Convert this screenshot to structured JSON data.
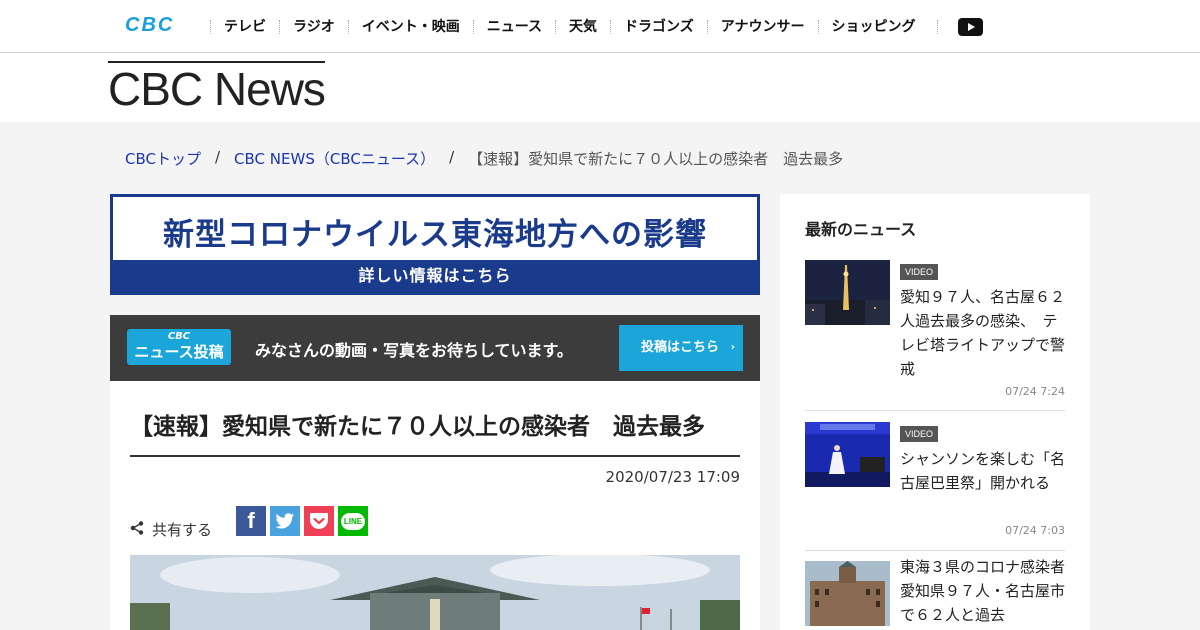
{
  "header": {
    "logo": "CBC",
    "nav": [
      "テレビ",
      "ラジオ",
      "イベント・映画",
      "ニュース",
      "天気",
      "ドラゴンズ",
      "アナウンサー",
      "ショッピング"
    ]
  },
  "masthead": {
    "brand": "CBC News"
  },
  "breadcrumb": {
    "home": "CBCトップ",
    "section": "CBC NEWS（CBCニュース）",
    "current": "【速報】愛知県で新たに７０人以上の感染者　過去最多",
    "separator": "/"
  },
  "banner_covid": {
    "main": "新型コロナウイルス東海地方への影響",
    "sub": "詳しい情報はこちら"
  },
  "banner_submit": {
    "badge_small": "CBC",
    "badge_big": "ニュース投稿",
    "text": "みなさんの動画・写真をお待ちしています。",
    "button": "投稿はこちら",
    "arrow": "›"
  },
  "article": {
    "title": "【速報】愛知県で新たに７０人以上の感染者　過去最多",
    "date": "2020/07/23 17:09",
    "share_label": "共有する",
    "share_buttons": [
      {
        "label": "f",
        "color": "#3b5998"
      },
      {
        "label": "t",
        "color": "#4aa3df"
      },
      {
        "label": "P",
        "color": "#ef4056"
      },
      {
        "label": "LINE",
        "color": "#00b900"
      }
    ]
  },
  "sidebar": {
    "heading": "最新のニュース",
    "items": [
      {
        "badge": "VIDEO",
        "title": "愛知９７人、名古屋６２人過去最多の感染、　テレビ塔ライトアップで警戒",
        "time": "07/24 7:24"
      },
      {
        "badge": "VIDEO",
        "title": "シャンソンを楽しむ「名古屋巴里祭」開かれる",
        "time": "07/24 7:03"
      },
      {
        "badge": "",
        "title": "東海３県のコロナ感染者　愛知県９７人・名古屋市で６２人と過去",
        "time": ""
      }
    ]
  },
  "colors": {
    "accent": "#1ba5d8",
    "covid_blue": "#1a3a8c",
    "link": "#1a35b0"
  }
}
